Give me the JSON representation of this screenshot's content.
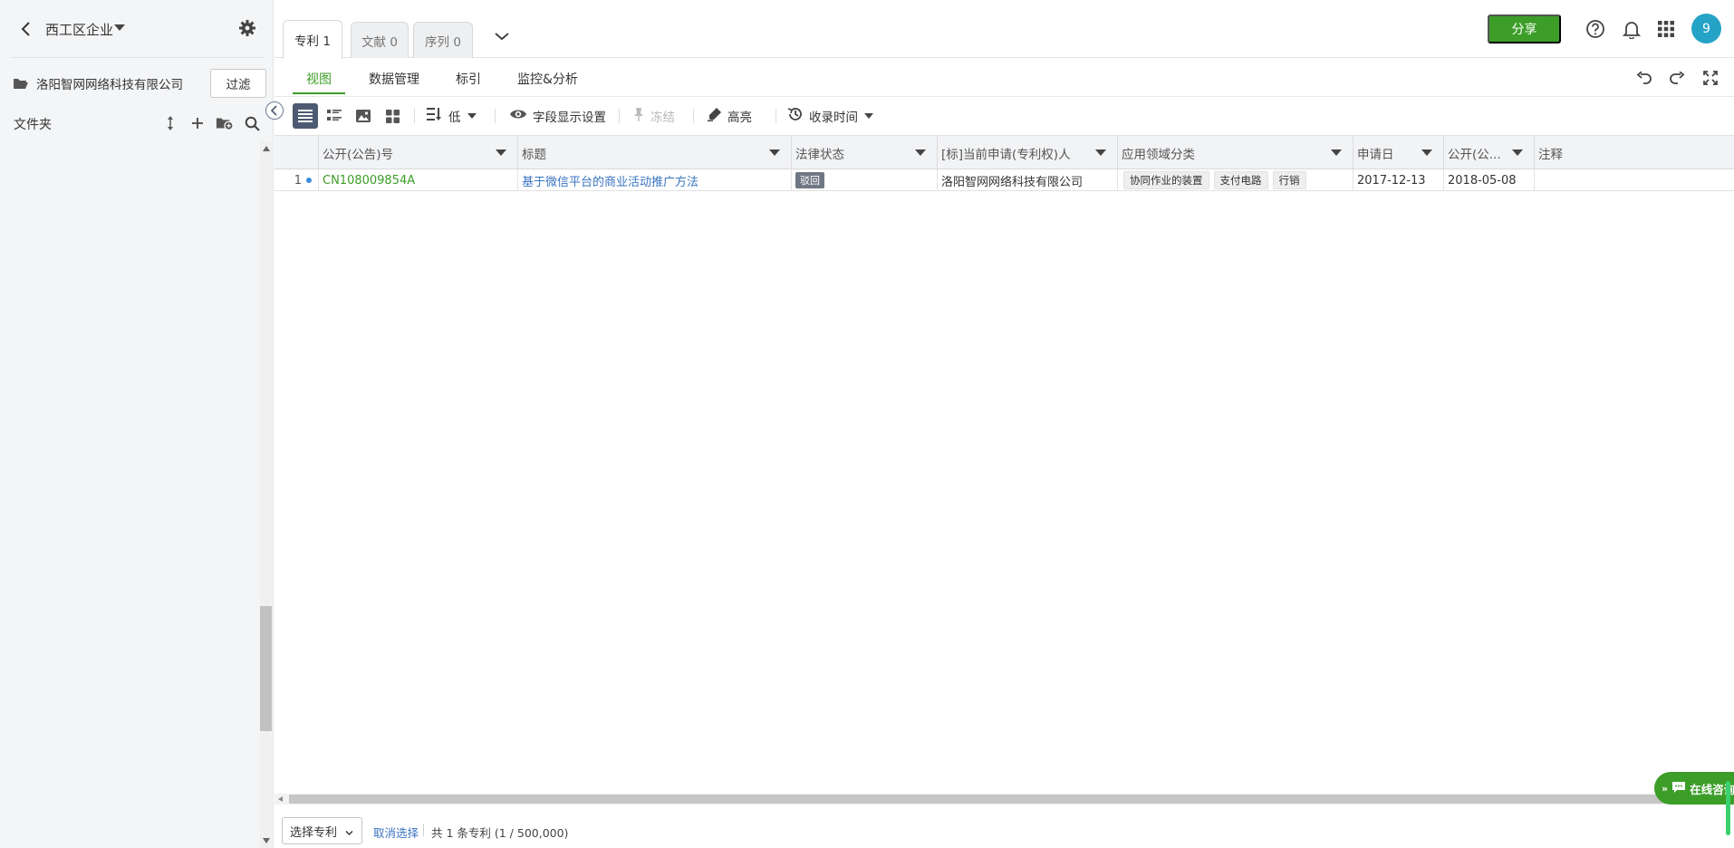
{
  "sidebar": {
    "title": "西工区企业",
    "org_name": "洛阳智网网络科技有限公司",
    "filter_label": "过滤",
    "folder_label": "文件夹"
  },
  "tabs": [
    {
      "label": "专利 1"
    },
    {
      "label": "文献 0"
    },
    {
      "label": "序列 0"
    }
  ],
  "header": {
    "share_label": "分享",
    "avatar_text": "9"
  },
  "subtabs": [
    {
      "label": "视图"
    },
    {
      "label": "数据管理"
    },
    {
      "label": "标引"
    },
    {
      "label": "监控&分析"
    }
  ],
  "toolbar": {
    "priority_label": "低",
    "field_settings_label": "字段显示设置",
    "freeze_label": "冻结",
    "highlight_label": "高亮",
    "sort_label": "收录时间"
  },
  "table": {
    "columns": [
      "公开(公告)号",
      "标题",
      "法律状态",
      "[标]当前申请(专利权)人",
      "应用领域分类",
      "申请日",
      "公开(公...",
      "注释"
    ],
    "rows": [
      {
        "index": "1",
        "pub_number": "CN108009854A",
        "title": "基于微信平台的商业活动推广方法",
        "legal_status": "驳回",
        "applicant": "洛阳智网网络科技有限公司",
        "tags": [
          "协同作业的装置",
          "支付电路",
          "行销"
        ],
        "app_date": "2017-12-13",
        "pub_date": "2018-05-08",
        "note": ""
      }
    ]
  },
  "footer": {
    "select_label": "选择专利",
    "deselect_label": "取消选择",
    "count_text": "共 1 条专利 (1 / 500,000)"
  },
  "consult": {
    "label": "在线咨询"
  },
  "colors": {
    "primary_green": "#3c9e28",
    "link_blue": "#3a74c1",
    "avatar": "#24a3c7"
  }
}
